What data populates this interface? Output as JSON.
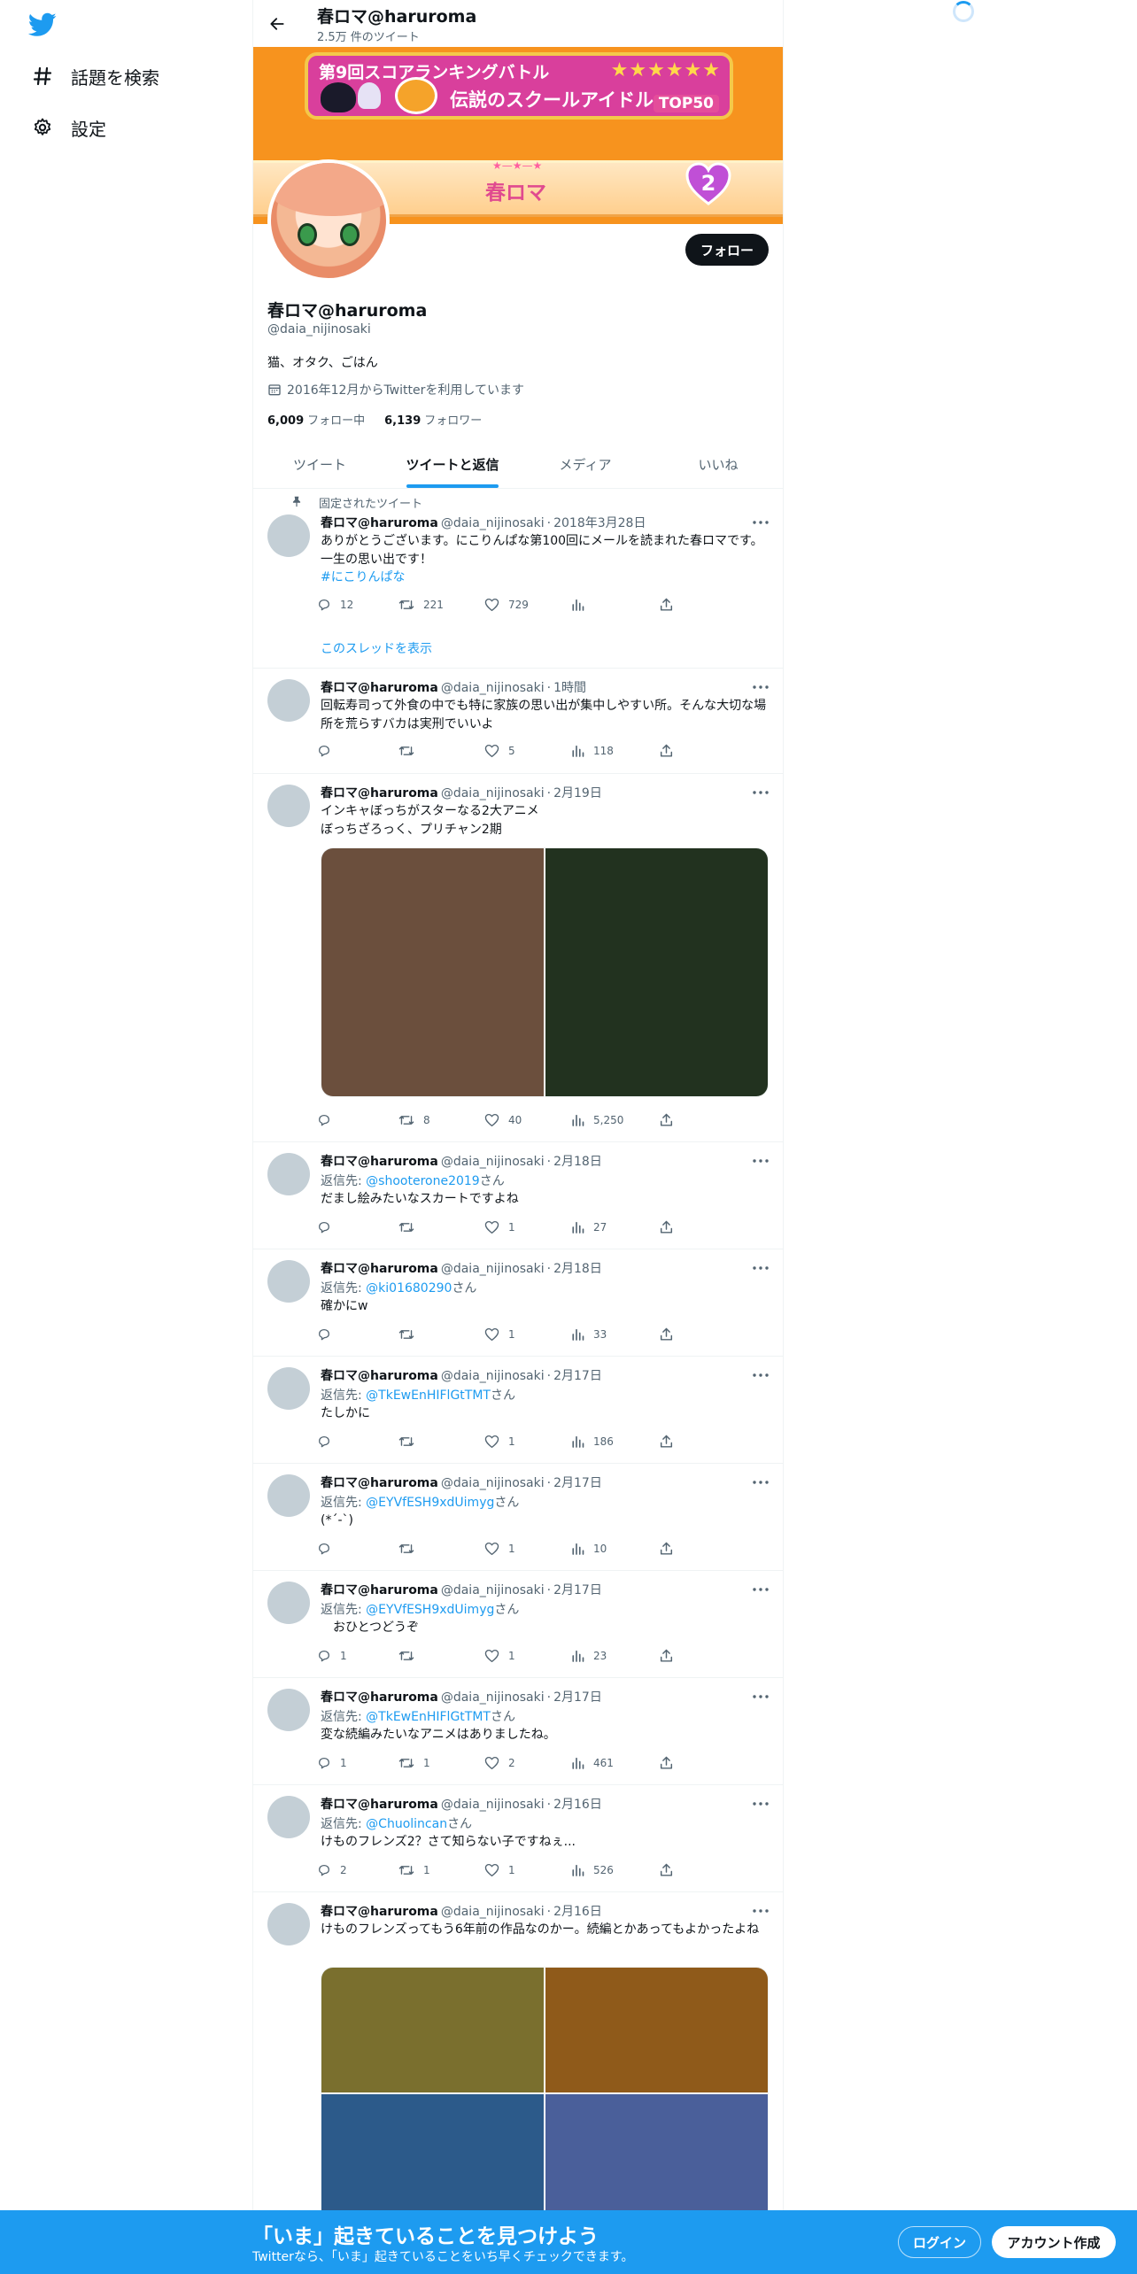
{
  "nav": {
    "explore_label": "話題を検索",
    "settings_label": "設定"
  },
  "header": {
    "name": "春ロマ@haruroma",
    "tweet_count": "2.5万 件のツイート"
  },
  "banner": {
    "event_title": "第9回スコアランキングバトル",
    "event_subtitle": "伝説のスクールアイドル",
    "stars": "★★★★★★",
    "rank": "TOP50",
    "character_name": "春ロマ",
    "level": "2"
  },
  "profile": {
    "follow_label": "フォロー",
    "name": "春ロマ@haruroma",
    "handle": "@daia_nijinosaki",
    "bio": "猫、オタク、ごはん",
    "joined": "2016年12月からTwitterを利用しています",
    "following_count": "6,009",
    "following_label": "フォロー中",
    "followers_count": "6,139",
    "followers_label": "フォロワー"
  },
  "tabs": [
    "ツイート",
    "ツイートと返信",
    "メディア",
    "いいね"
  ],
  "pinned_label": "固定されたツイート",
  "reply_prefix": "返信先: ",
  "reply_suffix": "さん",
  "thread_link": "このスレッドを表示",
  "tweets": [
    {
      "name": "春ロマ@haruroma",
      "handle": "@daia_nijinosaki",
      "time": "2018年3月28日",
      "text": "ありがとうございます。にこりんぱな第100回にメールを読まれた春ロマです。一生の思い出です！",
      "hashtag": "#にこりんぱな",
      "replies": "12",
      "retweets": "221",
      "likes": "729",
      "views": ""
    },
    {
      "name": "春ロマ@haruroma",
      "handle": "@daia_nijinosaki",
      "time": "1時間",
      "text": "回転寿司って外食の中でも特に家族の思い出が集中しやすい所。そんな大切な場所を荒らすバカは実刑でいいよ",
      "replies": "",
      "retweets": "",
      "likes": "5",
      "views": "118"
    },
    {
      "name": "春ロマ@haruroma",
      "handle": "@daia_nijinosaki",
      "time": "2月19日",
      "text": "インキャぼっちがスターなる2大アニメ\nぼっちざろっく、プリチャン2期",
      "replies": "",
      "retweets": "8",
      "likes": "40",
      "views": "5,250",
      "media_colors": [
        "#6b4f3d",
        "#22321f"
      ]
    },
    {
      "name": "春ロマ@haruroma",
      "handle": "@daia_nijinosaki",
      "time": "2月18日",
      "reply_to": "@shooterone2019",
      "text": "だまし絵みたいなスカートですよね",
      "replies": "",
      "retweets": "",
      "likes": "1",
      "views": "27"
    },
    {
      "name": "春ロマ@haruroma",
      "handle": "@daia_nijinosaki",
      "time": "2月18日",
      "reply_to": "@ki01680290",
      "text": "確かにw",
      "replies": "",
      "retweets": "",
      "likes": "1",
      "views": "33"
    },
    {
      "name": "春ロマ@haruroma",
      "handle": "@daia_nijinosaki",
      "time": "2月17日",
      "reply_to": "@TkEwEnHIFlGtTMT",
      "text": "たしかに",
      "replies": "",
      "retweets": "",
      "likes": "1",
      "views": "186"
    },
    {
      "name": "春ロマ@haruroma",
      "handle": "@daia_nijinosaki",
      "time": "2月17日",
      "reply_to": "@EYVfESH9xdUimyg",
      "text": "(*´-`)",
      "replies": "",
      "retweets": "",
      "likes": "1",
      "views": "10"
    },
    {
      "name": "春ロマ@haruroma",
      "handle": "@daia_nijinosaki",
      "time": "2月17日",
      "reply_to": "@EYVfESH9xdUimyg",
      "text": "　おひとつどうぞ",
      "replies": "1",
      "retweets": "",
      "likes": "1",
      "views": "23"
    },
    {
      "name": "春ロマ@haruroma",
      "handle": "@daia_nijinosaki",
      "time": "2月17日",
      "reply_to": "@TkEwEnHIFlGtTMT",
      "text": "変な続編みたいなアニメはありましたね。",
      "replies": "1",
      "retweets": "1",
      "likes": "2",
      "views": "461"
    },
    {
      "name": "春ロマ@haruroma",
      "handle": "@daia_nijinosaki",
      "time": "2月16日",
      "reply_to": "@Chuolincan",
      "text": "けものフレンズ2？さて知らない子ですねぇ...",
      "replies": "2",
      "retweets": "1",
      "likes": "1",
      "views": "526"
    },
    {
      "name": "春ロマ@haruroma",
      "handle": "@daia_nijinosaki",
      "time": "2月16日",
      "text": "けものフレンズってもう6年前の作品なのかー。続編とかあってもよかったよね",
      "media_colors": [
        "#7a6f2e",
        "#8f5a1a",
        "#2c5a8a",
        "#4a5f9a"
      ]
    }
  ],
  "bottom": {
    "headline": "「いま」起きていることを見つけよう",
    "sub": "Twitterなら、「いま」起きていることをいち早くチェックできます。",
    "login_label": "ログイン",
    "signup_label": "アカウント作成"
  },
  "colors": {
    "accent": "#1d9bf0",
    "banner": "#f7931e",
    "text": "#0f1419",
    "secondary": "#536471"
  }
}
